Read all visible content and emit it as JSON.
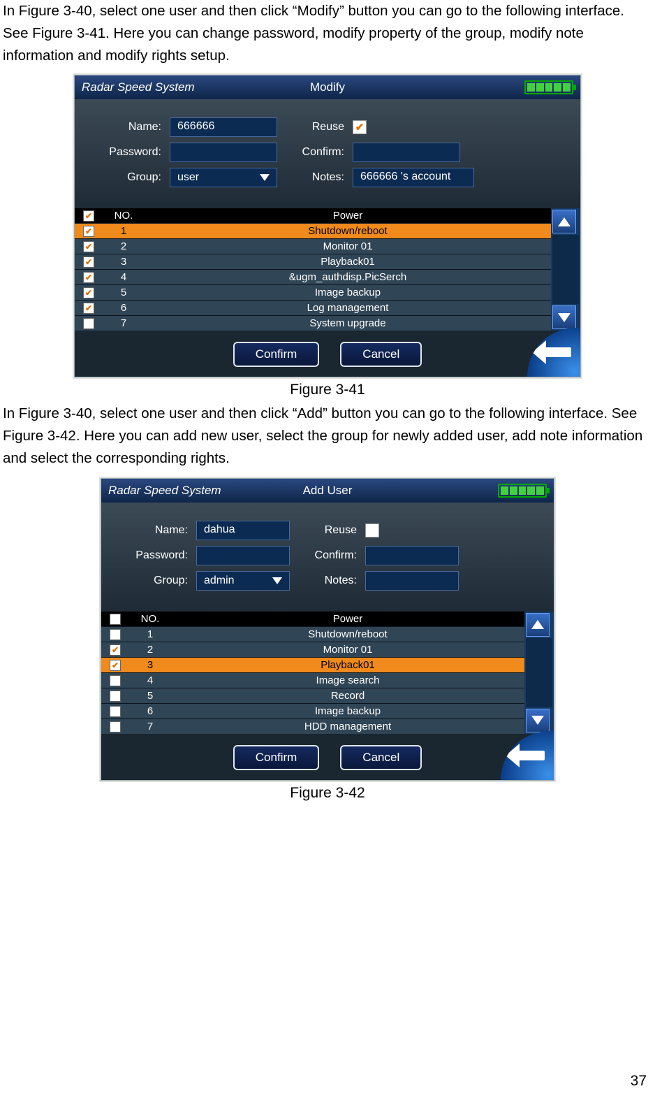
{
  "para1": "In Figure 3-40, select one user and then click “Modify” button you can go to the following interface. See Figure 3-41. Here you can change password, modify property of the group, modify note information and modify rights setup.",
  "caption1": "Figure 3-41",
  "para2": "In Figure 3-40, select one user and then click “Add” button you can go to the following interface. See Figure 3-42. Here you can add new user, select the group for newly added user, add note information and select the corresponding rights.",
  "caption2": "Figure 3-42",
  "page_number": "37",
  "common": {
    "system_label": "Radar Speed System",
    "name_label": "Name:",
    "reuse_label": "Reuse",
    "password_label": "Password:",
    "confirm_label": "Confirm:",
    "group_label": "Group:",
    "notes_label": "Notes:",
    "col_no": "NO.",
    "col_power": "Power",
    "confirm_btn": "Confirm",
    "cancel_btn": "Cancel"
  },
  "fig41": {
    "mode": "Modify",
    "name_value": "666666",
    "reuse_checked": true,
    "password_value": "",
    "confirm_value": "",
    "group_value": "user",
    "notes_value": "666666 's account",
    "header_checked": true,
    "rows": [
      {
        "no": "1",
        "label": "Shutdown/reboot",
        "checked": true,
        "selected": true
      },
      {
        "no": "2",
        "label": "Monitor 01",
        "checked": true,
        "selected": false
      },
      {
        "no": "3",
        "label": "Playback01",
        "checked": true,
        "selected": false
      },
      {
        "no": "4",
        "label": "&ugm_authdisp.PicSerch",
        "checked": true,
        "selected": false
      },
      {
        "no": "5",
        "label": "Image backup",
        "checked": true,
        "selected": false
      },
      {
        "no": "6",
        "label": "Log management",
        "checked": true,
        "selected": false
      },
      {
        "no": "7",
        "label": "System upgrade",
        "checked": false,
        "selected": false
      }
    ]
  },
  "fig42": {
    "mode": "Add User",
    "name_value": "dahua",
    "reuse_checked": false,
    "password_value": "",
    "confirm_value": "",
    "group_value": "admin",
    "notes_value": "",
    "header_checked": false,
    "rows": [
      {
        "no": "1",
        "label": "Shutdown/reboot",
        "checked": false,
        "selected": false
      },
      {
        "no": "2",
        "label": "Monitor 01",
        "checked": true,
        "selected": false
      },
      {
        "no": "3",
        "label": "Playback01",
        "checked": true,
        "selected": true
      },
      {
        "no": "4",
        "label": "Image search",
        "checked": false,
        "selected": false
      },
      {
        "no": "5",
        "label": "Record",
        "checked": false,
        "selected": false
      },
      {
        "no": "6",
        "label": "Image backup",
        "checked": false,
        "selected": false
      },
      {
        "no": "7",
        "label": "HDD management",
        "checked": false,
        "selected": false
      }
    ]
  }
}
